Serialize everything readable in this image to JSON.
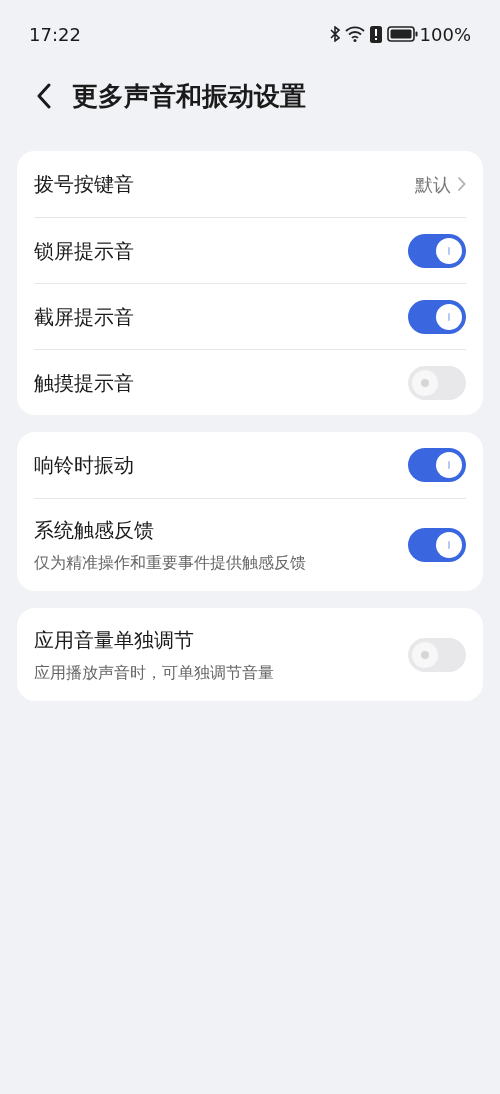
{
  "status_bar": {
    "time": "17:22",
    "battery": "100%"
  },
  "header": {
    "title": "更多声音和振动设置"
  },
  "groups": [
    {
      "rows": [
        {
          "kind": "value",
          "label": "拨号按键音",
          "value": "默认"
        },
        {
          "kind": "toggle",
          "label": "锁屏提示音",
          "on": true
        },
        {
          "kind": "toggle",
          "label": "截屏提示音",
          "on": true
        },
        {
          "kind": "toggle",
          "label": "触摸提示音",
          "on": false
        }
      ]
    },
    {
      "rows": [
        {
          "kind": "toggle",
          "label": "响铃时振动",
          "on": true
        },
        {
          "kind": "toggle",
          "label": "系统触感反馈",
          "subtitle": "仅为精准操作和重要事件提供触感反馈",
          "on": true
        }
      ]
    },
    {
      "rows": [
        {
          "kind": "toggle",
          "label": "应用音量单独调节",
          "subtitle": "应用播放声音时，可单独调节音量",
          "on": false
        }
      ]
    }
  ]
}
